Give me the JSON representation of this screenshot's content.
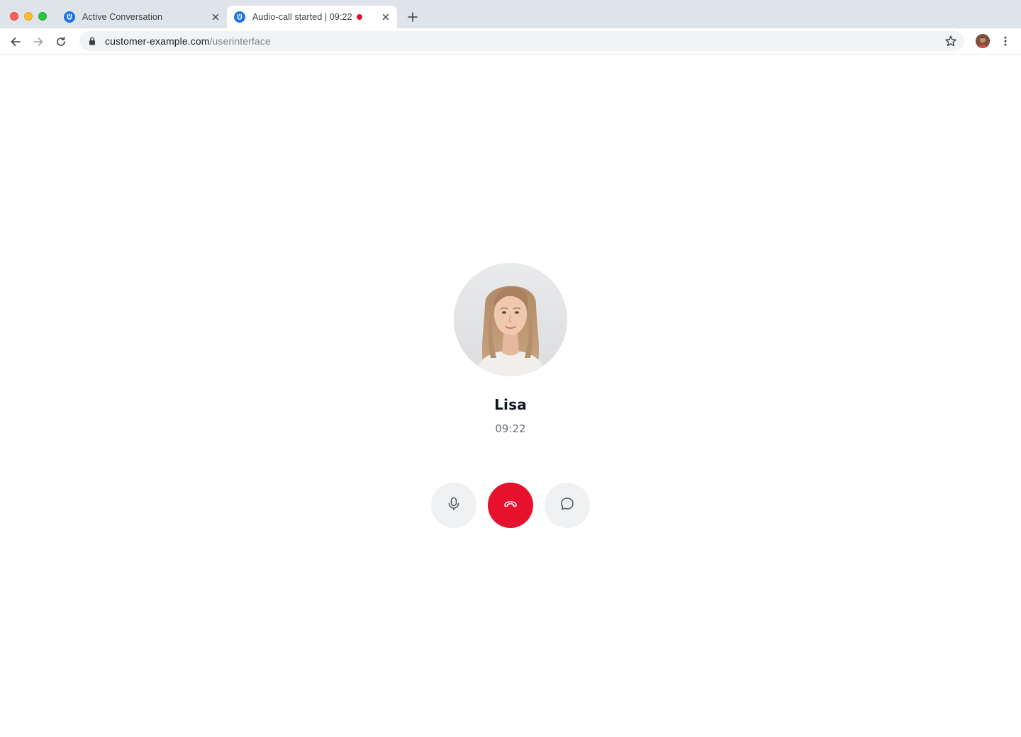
{
  "browser": {
    "tabs": [
      {
        "title": "Active Conversation",
        "active": false,
        "favicon": "u-logo-icon"
      },
      {
        "title": "Audio-call started | 09:22",
        "active": true,
        "favicon": "u-logo-icon",
        "recording": true
      }
    ],
    "address": {
      "host": "customer-example.com",
      "path": "/userinterface"
    }
  },
  "call": {
    "caller_name": "Lisa",
    "duration": "09:22",
    "controls": [
      {
        "name": "mute",
        "icon": "microphone-icon"
      },
      {
        "name": "hang-up",
        "icon": "phone-hangup-icon"
      },
      {
        "name": "chat",
        "icon": "chat-bubble-icon"
      }
    ]
  },
  "colors": {
    "accent": "#1a73e8",
    "hangup": "#e8112d",
    "recording_dot": "#e8112d",
    "control_bg": "#f0f1f3"
  }
}
